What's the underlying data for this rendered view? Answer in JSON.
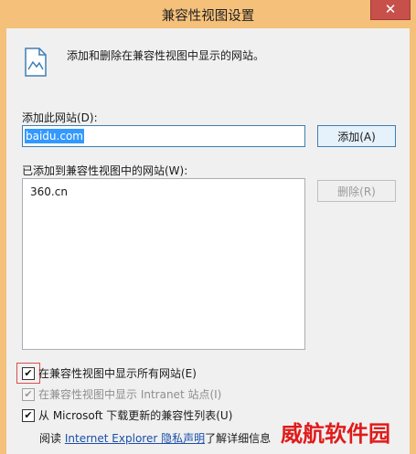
{
  "window": {
    "title": "兼容性视图设置",
    "close_glyph": "✕"
  },
  "description": "添加和删除在兼容性视图中显示的网站。",
  "add_site": {
    "label": "添加此网站(D):",
    "value": "baidu.com",
    "add_button": "添加(A)"
  },
  "site_list": {
    "label": "已添加到兼容性视图中的网站(W):",
    "items": [
      "360.cn"
    ],
    "remove_button": "删除(R)"
  },
  "options": {
    "show_all": {
      "label": "在兼容性视图中显示所有网站(E)",
      "checked": true
    },
    "intranet": {
      "label": "在兼容性视图中显示 Intranet 站点(I)",
      "checked": true,
      "disabled": true
    },
    "download_updates": {
      "label": "从 Microsoft 下载更新的兼容性列表(U)",
      "checked": true
    }
  },
  "footer": {
    "prefix": "阅读",
    "link": "Internet Explorer 隐私声明",
    "suffix": "了解详细信息"
  },
  "watermark": "威航软件园",
  "colors": {
    "title_bar": "#f5c07a",
    "close_button": "#c7504a",
    "selection": "#3399ff",
    "link": "#1a4fa8",
    "watermark": "#e01b1b"
  },
  "icons": [
    "document-image-icon",
    "close-icon",
    "checkbox-check-icon"
  ]
}
